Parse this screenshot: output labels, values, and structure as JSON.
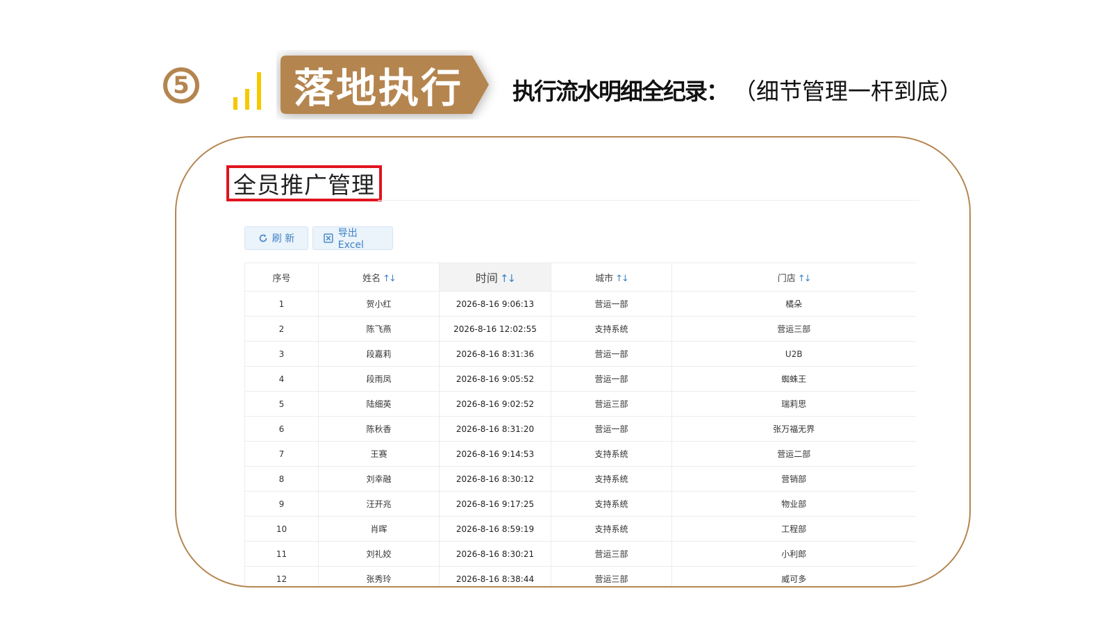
{
  "header": {
    "step_number": "5",
    "banner_title": "落地执行",
    "description_main": "执行流水明细全纪录：",
    "description_sub": "（细节管理一杆到底）",
    "accent_color": "#b58550",
    "signal_color": "#f5c800"
  },
  "panel": {
    "title": "全员推广管理",
    "title_border_color": "#e0141e",
    "toolbar": {
      "refresh_label": "刷 新",
      "export_label": "导出Excel"
    },
    "table": {
      "columns": [
        {
          "label": "序号",
          "sortable": false
        },
        {
          "label": "姓名",
          "sortable": true
        },
        {
          "label": "时间",
          "sortable": true,
          "active": true
        },
        {
          "label": "城市",
          "sortable": true
        },
        {
          "label": "门店",
          "sortable": true
        }
      ],
      "sort_glyph": "↑↓",
      "rows": [
        {
          "index": "1",
          "name": "贺小红",
          "time": "2026-8-16 9:06:13",
          "city": "营运一部",
          "store": "橘朵"
        },
        {
          "index": "2",
          "name": "陈飞燕",
          "time": "2026-8-16 12:02:55",
          "city": "支持系统",
          "store": "营运三部"
        },
        {
          "index": "3",
          "name": "段嘉莉",
          "time": "2026-8-16 8:31:36",
          "city": "营运一部",
          "store": "U2B"
        },
        {
          "index": "4",
          "name": "段雨凤",
          "time": "2026-8-16 9:05:52",
          "city": "营运一部",
          "store": "蜘蛛王"
        },
        {
          "index": "5",
          "name": "陆细英",
          "time": "2026-8-16 9:02:52",
          "city": "营运三部",
          "store": "瑞莉思"
        },
        {
          "index": "6",
          "name": "陈秋香",
          "time": "2026-8-16 8:31:20",
          "city": "营运一部",
          "store": "张万福无界"
        },
        {
          "index": "7",
          "name": "王赛",
          "time": "2026-8-16 9:14:53",
          "city": "支持系统",
          "store": "营运二部"
        },
        {
          "index": "8",
          "name": "刘幸融",
          "time": "2026-8-16 8:30:12",
          "city": "支持系统",
          "store": "营销部"
        },
        {
          "index": "9",
          "name": "汪开兆",
          "time": "2026-8-16 9:17:25",
          "city": "支持系统",
          "store": "物业部"
        },
        {
          "index": "10",
          "name": "肖晖",
          "time": "2026-8-16 8:59:19",
          "city": "支持系统",
          "store": "工程部"
        },
        {
          "index": "11",
          "name": "刘礼姣",
          "time": "2026-8-16 8:30:21",
          "city": "营运三部",
          "store": "小利郎"
        },
        {
          "index": "12",
          "name": "张秀玲",
          "time": "2026-8-16 8:38:44",
          "city": "营运三部",
          "store": "威可多"
        }
      ]
    }
  }
}
